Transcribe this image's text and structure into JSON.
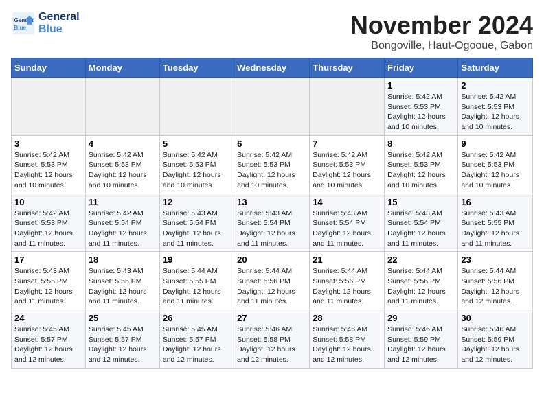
{
  "logo": {
    "text_general": "General",
    "text_blue": "Blue"
  },
  "title": "November 2024",
  "subtitle": "Bongoville, Haut-Ogooue, Gabon",
  "days_of_week": [
    "Sunday",
    "Monday",
    "Tuesday",
    "Wednesday",
    "Thursday",
    "Friday",
    "Saturday"
  ],
  "weeks": [
    [
      {
        "day": "",
        "info": ""
      },
      {
        "day": "",
        "info": ""
      },
      {
        "day": "",
        "info": ""
      },
      {
        "day": "",
        "info": ""
      },
      {
        "day": "",
        "info": ""
      },
      {
        "day": "1",
        "info": "Sunrise: 5:42 AM\nSunset: 5:53 PM\nDaylight: 12 hours\nand 10 minutes."
      },
      {
        "day": "2",
        "info": "Sunrise: 5:42 AM\nSunset: 5:53 PM\nDaylight: 12 hours\nand 10 minutes."
      }
    ],
    [
      {
        "day": "3",
        "info": "Sunrise: 5:42 AM\nSunset: 5:53 PM\nDaylight: 12 hours\nand 10 minutes."
      },
      {
        "day": "4",
        "info": "Sunrise: 5:42 AM\nSunset: 5:53 PM\nDaylight: 12 hours\nand 10 minutes."
      },
      {
        "day": "5",
        "info": "Sunrise: 5:42 AM\nSunset: 5:53 PM\nDaylight: 12 hours\nand 10 minutes."
      },
      {
        "day": "6",
        "info": "Sunrise: 5:42 AM\nSunset: 5:53 PM\nDaylight: 12 hours\nand 10 minutes."
      },
      {
        "day": "7",
        "info": "Sunrise: 5:42 AM\nSunset: 5:53 PM\nDaylight: 12 hours\nand 10 minutes."
      },
      {
        "day": "8",
        "info": "Sunrise: 5:42 AM\nSunset: 5:53 PM\nDaylight: 12 hours\nand 10 minutes."
      },
      {
        "day": "9",
        "info": "Sunrise: 5:42 AM\nSunset: 5:53 PM\nDaylight: 12 hours\nand 10 minutes."
      }
    ],
    [
      {
        "day": "10",
        "info": "Sunrise: 5:42 AM\nSunset: 5:53 PM\nDaylight: 12 hours\nand 11 minutes."
      },
      {
        "day": "11",
        "info": "Sunrise: 5:42 AM\nSunset: 5:54 PM\nDaylight: 12 hours\nand 11 minutes."
      },
      {
        "day": "12",
        "info": "Sunrise: 5:43 AM\nSunset: 5:54 PM\nDaylight: 12 hours\nand 11 minutes."
      },
      {
        "day": "13",
        "info": "Sunrise: 5:43 AM\nSunset: 5:54 PM\nDaylight: 12 hours\nand 11 minutes."
      },
      {
        "day": "14",
        "info": "Sunrise: 5:43 AM\nSunset: 5:54 PM\nDaylight: 12 hours\nand 11 minutes."
      },
      {
        "day": "15",
        "info": "Sunrise: 5:43 AM\nSunset: 5:54 PM\nDaylight: 12 hours\nand 11 minutes."
      },
      {
        "day": "16",
        "info": "Sunrise: 5:43 AM\nSunset: 5:55 PM\nDaylight: 12 hours\nand 11 minutes."
      }
    ],
    [
      {
        "day": "17",
        "info": "Sunrise: 5:43 AM\nSunset: 5:55 PM\nDaylight: 12 hours\nand 11 minutes."
      },
      {
        "day": "18",
        "info": "Sunrise: 5:43 AM\nSunset: 5:55 PM\nDaylight: 12 hours\nand 11 minutes."
      },
      {
        "day": "19",
        "info": "Sunrise: 5:44 AM\nSunset: 5:55 PM\nDaylight: 12 hours\nand 11 minutes."
      },
      {
        "day": "20",
        "info": "Sunrise: 5:44 AM\nSunset: 5:56 PM\nDaylight: 12 hours\nand 11 minutes."
      },
      {
        "day": "21",
        "info": "Sunrise: 5:44 AM\nSunset: 5:56 PM\nDaylight: 12 hours\nand 11 minutes."
      },
      {
        "day": "22",
        "info": "Sunrise: 5:44 AM\nSunset: 5:56 PM\nDaylight: 12 hours\nand 11 minutes."
      },
      {
        "day": "23",
        "info": "Sunrise: 5:44 AM\nSunset: 5:56 PM\nDaylight: 12 hours\nand 12 minutes."
      }
    ],
    [
      {
        "day": "24",
        "info": "Sunrise: 5:45 AM\nSunset: 5:57 PM\nDaylight: 12 hours\nand 12 minutes."
      },
      {
        "day": "25",
        "info": "Sunrise: 5:45 AM\nSunset: 5:57 PM\nDaylight: 12 hours\nand 12 minutes."
      },
      {
        "day": "26",
        "info": "Sunrise: 5:45 AM\nSunset: 5:57 PM\nDaylight: 12 hours\nand 12 minutes."
      },
      {
        "day": "27",
        "info": "Sunrise: 5:46 AM\nSunset: 5:58 PM\nDaylight: 12 hours\nand 12 minutes."
      },
      {
        "day": "28",
        "info": "Sunrise: 5:46 AM\nSunset: 5:58 PM\nDaylight: 12 hours\nand 12 minutes."
      },
      {
        "day": "29",
        "info": "Sunrise: 5:46 AM\nSunset: 5:59 PM\nDaylight: 12 hours\nand 12 minutes."
      },
      {
        "day": "30",
        "info": "Sunrise: 5:46 AM\nSunset: 5:59 PM\nDaylight: 12 hours\nand 12 minutes."
      }
    ]
  ]
}
